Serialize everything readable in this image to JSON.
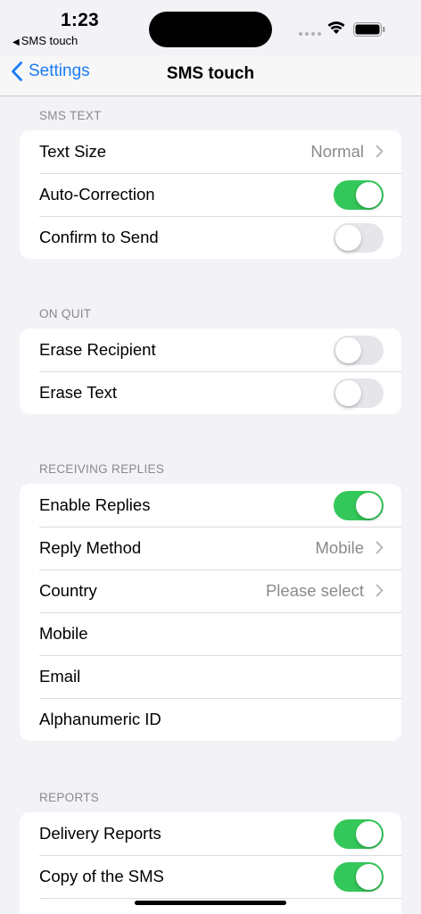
{
  "status_bar": {
    "time": "1:23",
    "back_app_label": "SMS touch"
  },
  "nav": {
    "back_label": "Settings",
    "title": "SMS touch"
  },
  "colors": {
    "accent": "#1a7cf5",
    "toggle_on": "#34c759",
    "toggle_off": "#e5e5ea"
  },
  "sections": {
    "sms_text": {
      "header": "SMS TEXT",
      "text_size": {
        "label": "Text Size",
        "value": "Normal"
      },
      "auto_correction": {
        "label": "Auto-Correction",
        "on": true
      },
      "confirm_to_send": {
        "label": "Confirm to Send",
        "on": false
      }
    },
    "on_quit": {
      "header": "ON QUIT",
      "erase_recipient": {
        "label": "Erase Recipient",
        "on": false
      },
      "erase_text": {
        "label": "Erase Text",
        "on": false
      }
    },
    "receiving_replies": {
      "header": "RECEIVING REPLIES",
      "enable_replies": {
        "label": "Enable Replies",
        "on": true
      },
      "reply_method": {
        "label": "Reply Method",
        "value": "Mobile"
      },
      "country": {
        "label": "Country",
        "value": "Please select"
      },
      "mobile": {
        "label": "Mobile"
      },
      "email": {
        "label": "Email"
      },
      "alphanumeric_id": {
        "label": "Alphanumeric ID"
      }
    },
    "reports": {
      "header": "REPORTS",
      "delivery_reports": {
        "label": "Delivery Reports",
        "on": true
      },
      "copy_of_sms": {
        "label": "Copy of the SMS",
        "on": true
      }
    }
  }
}
